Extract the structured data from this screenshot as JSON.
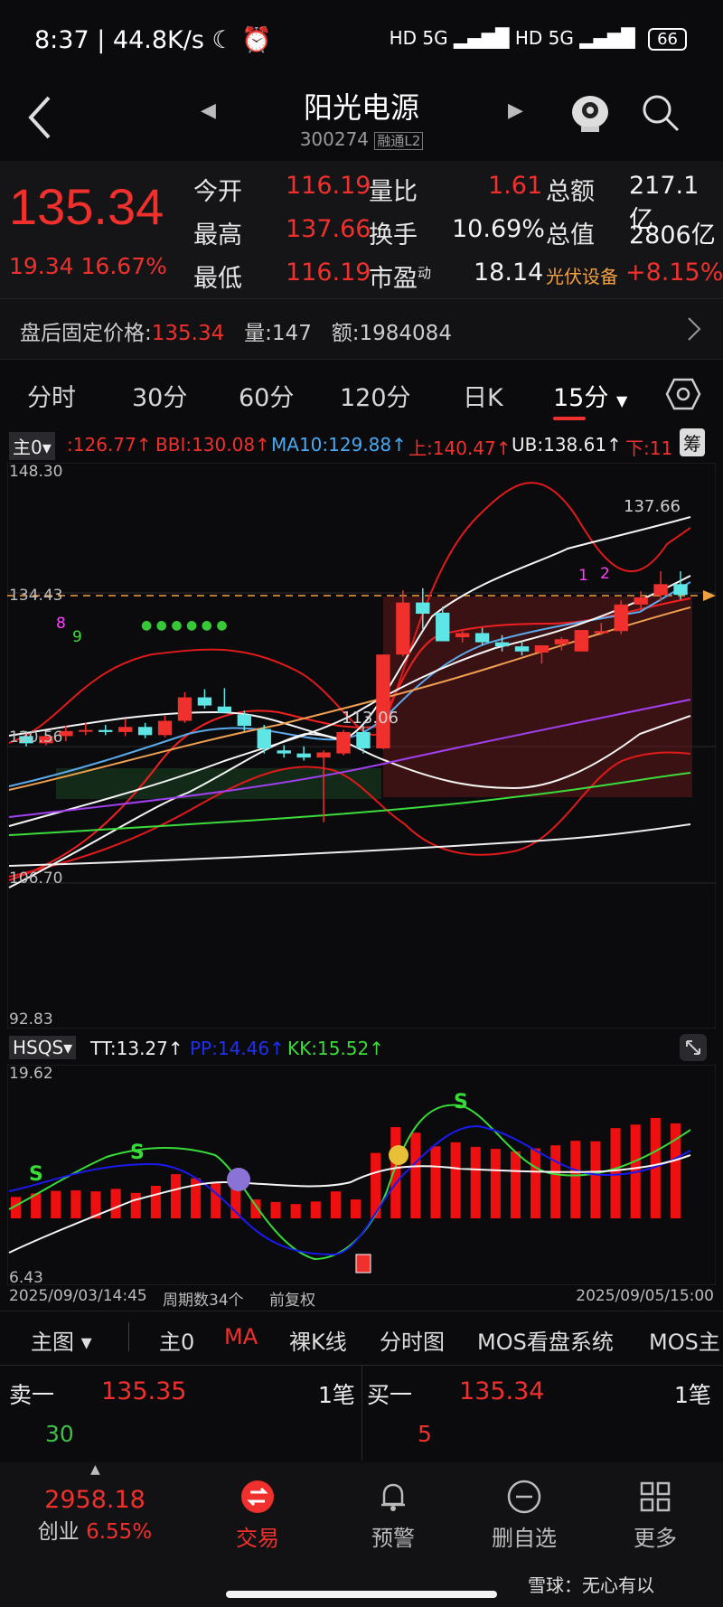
{
  "status_bar": {
    "time": "8:37",
    "net_speed": "44.8K/s",
    "battery": "66"
  },
  "header": {
    "title": "阳光电源",
    "code": "300274",
    "tags": "融通L2"
  },
  "quote": {
    "price": "135.34",
    "change": "19.34",
    "change_pct": "16.67%",
    "labels": {
      "open": "今开",
      "high": "最高",
      "low": "最低",
      "vol_ratio": "量比",
      "turnover": "换手",
      "pe": "市盈",
      "pe_sup": "动",
      "amount": "总额",
      "mkt_cap": "总值"
    },
    "open": "116.19",
    "high": "137.66",
    "low": "116.19",
    "vol_ratio": "1.61",
    "turnover": "10.69%",
    "pe": "18.14",
    "amount": "217.1亿",
    "mkt_cap": "2806亿",
    "sector": "光伏设备",
    "sector_pct": "+8.15%"
  },
  "after_hours": {
    "label": "盘后固定价格:",
    "price": "135.34",
    "vol_label": "量:",
    "vol": "147",
    "amt_label": "额:",
    "amt": "1984084"
  },
  "tabs": [
    "分时",
    "30分",
    "60分",
    "120分",
    "日K",
    "15分"
  ],
  "active_tab": "15分",
  "main_indicator": {
    "selector": "主0",
    "first": ":126.77↑",
    "bbi_label": "BBI:",
    "bbi": "130.08↑",
    "ma10_label": "MA10:",
    "ma10": "129.88↑",
    "up_label": "上:",
    "up": "140.47↑",
    "ub_label": "UB:",
    "ub": "138.61↑",
    "down": "下:11",
    "chip": "筹"
  },
  "main_axis": [
    "148.30",
    "134.43",
    "120.56",
    "106.70",
    "92.83"
  ],
  "annotations": {
    "high": "137.66",
    "low": "113.06",
    "m8": "8",
    "m9": "9",
    "m1": "1",
    "m2": "2"
  },
  "sub_indicator": {
    "selector": "HSQS",
    "tt_label": "TT:",
    "tt": "13.27↑",
    "pp_label": "PP:",
    "pp": "14.46↑",
    "kk_label": "KK:",
    "kk": "15.52↑",
    "axis": [
      "19.62",
      "6.43"
    ],
    "s": "S"
  },
  "footer_info": {
    "start": "2025/09/03/14:45",
    "periods": "周期数34个",
    "adjust": "前复权",
    "end": "2025/09/05/15:00"
  },
  "indicator_bar": [
    "主图",
    "主0",
    "MA",
    "裸K线",
    "分时图",
    "MOS看盘系统",
    "MOS主"
  ],
  "orderbook": {
    "sell_label": "卖一",
    "sell_price": "135.35",
    "sell_count": "1笔",
    "sell_vol": "30",
    "buy_label": "买一",
    "buy_price": "135.34",
    "buy_count": "1笔",
    "buy_vol": "5"
  },
  "nav": {
    "index_value": "2958.18",
    "index_name": "创业",
    "index_pct": "6.55%",
    "trade": "交易",
    "alert": "预警",
    "remove": "删自选",
    "more": "更多"
  },
  "watermark": "雪球：无心有以",
  "colors": {
    "up": "#f0302c",
    "down": "#5ee6e6",
    "bg": "#0b0b0d",
    "accent": "#f0a040"
  },
  "chart_data": {
    "type": "candlestick",
    "ylim": [
      92.83,
      148.3
    ],
    "ohlc": [
      [
        121.5,
        122.0,
        120.5,
        120.8
      ],
      [
        120.8,
        121.8,
        120.6,
        121.5
      ],
      [
        121.5,
        122.5,
        121.0,
        122.0
      ],
      [
        122.0,
        122.8,
        121.6,
        122.1
      ],
      [
        122.1,
        122.6,
        121.6,
        121.9
      ],
      [
        121.9,
        123.2,
        121.5,
        122.4
      ],
      [
        122.4,
        122.8,
        121.3,
        121.6
      ],
      [
        121.6,
        123.5,
        121.4,
        123.0
      ],
      [
        123.0,
        125.8,
        122.8,
        125.3
      ],
      [
        125.3,
        126.1,
        124.2,
        124.5
      ],
      [
        124.4,
        126.2,
        123.8,
        123.8
      ],
      [
        123.6,
        124.0,
        122.0,
        122.5
      ],
      [
        122.2,
        122.6,
        119.8,
        120.3
      ],
      [
        120.1,
        120.6,
        119.4,
        119.8
      ],
      [
        119.8,
        120.5,
        119.1,
        119.4
      ],
      [
        119.4,
        120.1,
        113.06,
        119.9
      ],
      [
        119.8,
        122.1,
        119.6,
        121.9
      ],
      [
        121.9,
        122.5,
        119.8,
        120.3
      ],
      [
        120.3,
        129.5,
        120.2,
        129.5
      ],
      [
        129.5,
        135.8,
        129.3,
        134.6
      ],
      [
        134.6,
        136.0,
        132.0,
        133.5
      ],
      [
        133.6,
        134.2,
        130.8,
        130.8
      ],
      [
        131.2,
        131.8,
        130.7,
        131.6
      ],
      [
        131.6,
        132.1,
        130.4,
        130.7
      ],
      [
        130.7,
        131.4,
        129.8,
        130.3
      ],
      [
        130.3,
        130.8,
        129.4,
        129.8
      ],
      [
        129.7,
        130.4,
        128.6,
        130.4
      ],
      [
        130.5,
        131.2,
        129.9,
        131.0
      ],
      [
        129.8,
        131.9,
        129.8,
        131.9
      ],
      [
        131.6,
        132.6,
        131.4,
        131.8
      ],
      [
        131.8,
        134.8,
        131.5,
        134.4
      ],
      [
        134.4,
        135.7,
        133.9,
        135.1
      ],
      [
        135.3,
        137.66,
        134.7,
        136.4
      ],
      [
        136.4,
        137.66,
        134.9,
        135.34
      ]
    ]
  }
}
